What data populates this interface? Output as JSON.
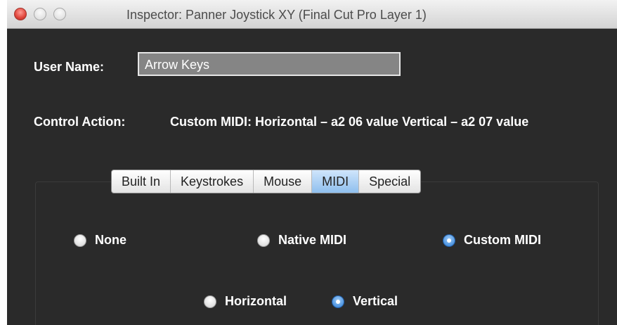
{
  "window": {
    "title": "Inspector: Panner Joystick XY (Final Cut Pro Layer 1)"
  },
  "user_name": {
    "label": "User Name:",
    "value": "Arrow Keys"
  },
  "control_action": {
    "label": "Control Action:",
    "value": "Custom MIDI: Horizontal – a2 06 value Vertical – a2 07 value"
  },
  "tabs": [
    {
      "label": "Built In",
      "selected": false
    },
    {
      "label": "Keystrokes",
      "selected": false
    },
    {
      "label": "Mouse",
      "selected": false
    },
    {
      "label": "MIDI",
      "selected": true
    },
    {
      "label": "Special",
      "selected": false
    }
  ],
  "midi_mode": {
    "options": [
      {
        "label": "None",
        "selected": false
      },
      {
        "label": "Native MIDI",
        "selected": false
      },
      {
        "label": "Custom MIDI",
        "selected": true
      }
    ]
  },
  "axis": {
    "options": [
      {
        "label": "Horizontal",
        "selected": false
      },
      {
        "label": "Vertical",
        "selected": true
      }
    ]
  },
  "colors": {
    "window_background": "#2a2a2a",
    "selected_tab": "#8fbfee",
    "selected_radio": "#2f7fd8"
  }
}
